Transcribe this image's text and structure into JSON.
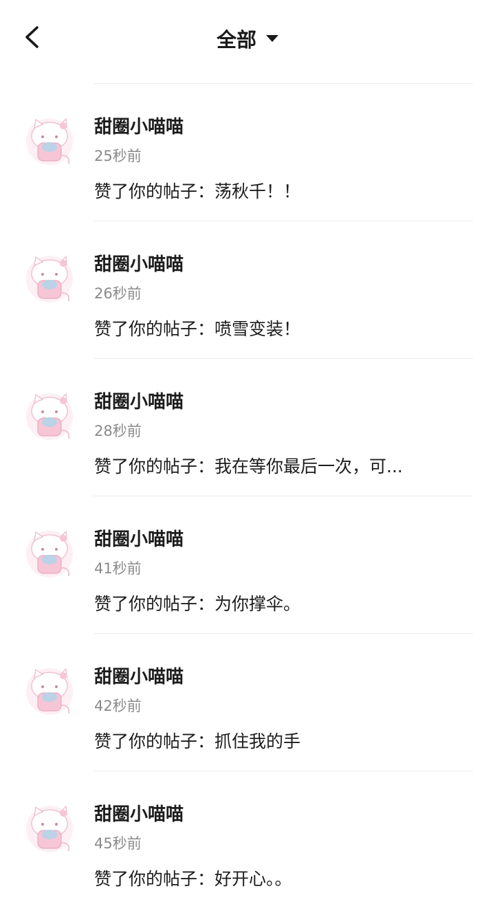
{
  "header": {
    "title": "全部",
    "back_icon": "chevron-left-icon",
    "dropdown_icon": "caret-down-icon"
  },
  "notifications": [
    {
      "name": "甜圈小喵喵",
      "time": "25秒前",
      "message": "赞了你的帖子：荡秋千！！"
    },
    {
      "name": "甜圈小喵喵",
      "time": "26秒前",
      "message": "赞了你的帖子：喷雪变装！"
    },
    {
      "name": "甜圈小喵喵",
      "time": "28秒前",
      "message": "赞了你的帖子：我在等你最后一次，可..."
    },
    {
      "name": "甜圈小喵喵",
      "time": "41秒前",
      "message": "赞了你的帖子：为你撑伞。"
    },
    {
      "name": "甜圈小喵喵",
      "time": "42秒前",
      "message": "赞了你的帖子：抓住我的手"
    },
    {
      "name": "甜圈小喵喵",
      "time": "45秒前",
      "message": "赞了你的帖子：好开心。。"
    }
  ],
  "colors": {
    "avatar_pink": "#f6c6d6",
    "avatar_blue": "#bcd2e6"
  }
}
